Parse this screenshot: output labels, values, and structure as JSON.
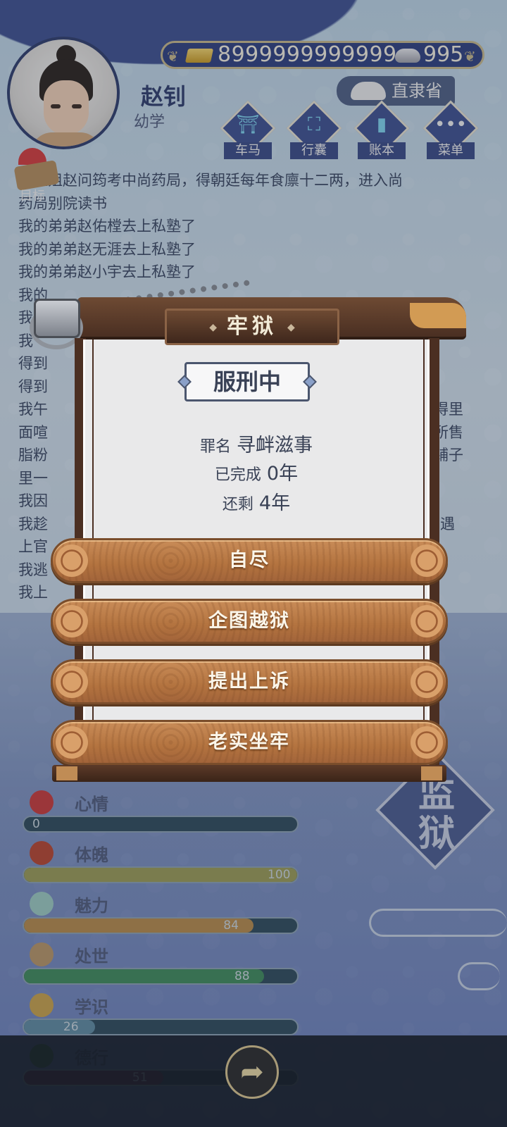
{
  "header": {
    "gold": "8999999999999",
    "silver": "995",
    "name": "赵钊",
    "rank": "幼学",
    "province": "直隶省",
    "nav": [
      {
        "label": "车马",
        "icon": "carriage-icon"
      },
      {
        "label": "行囊",
        "icon": "bag-icon"
      },
      {
        "label": "账本",
        "icon": "ledger-icon"
      },
      {
        "label": "菜单",
        "icon": "menu-icon"
      }
    ],
    "goal_label": "目标"
  },
  "log": [
    "我姐姐赵问筠考中尚药局，得朝廷每年食廪十二两，进入尚",
    "药局别院读书",
    "我的弟弟赵佑樘去上私塾了",
    "我的弟弟赵无涯去上私塾了",
    "我的弟弟赵小宇去上私塾了",
    "我的",
    "我",
    "我",
    "得到",
    "得到",
    "我午",
    "面喧",
    "脂粉",
    "里一",
    "我因",
    "我趁",
    "上官",
    "我逃",
    "我上"
  ],
  "log_right": [
    "得里",
    "所售",
    "铺子",
    "，遇"
  ],
  "modal": {
    "title": "牢狱",
    "status": "服刑中",
    "crime_label": "罪名",
    "crime": "寻衅滋事",
    "done_label": "已完成",
    "done": "0年",
    "remain_label": "还剩",
    "remain": "4年",
    "actions": [
      "自尽",
      "企图越狱",
      "提出上诉",
      "老实坐牢"
    ]
  },
  "stats": [
    {
      "name": "心情",
      "value": 0,
      "max": 100,
      "color": "#5a7a8a",
      "icon_color": "#c83a3a"
    },
    {
      "name": "体魄",
      "value": 100,
      "max": 100,
      "color": "#9a9a55",
      "icon_color": "#b8442e"
    },
    {
      "name": "魅力",
      "value": 84,
      "max": 100,
      "color": "#b68a4a",
      "icon_color": "#9cc9c0"
    },
    {
      "name": "处世",
      "value": 88,
      "max": 100,
      "color": "#3f8a5a",
      "icon_color": "#b89566"
    },
    {
      "name": "学识",
      "value": 26,
      "max": 100,
      "color": "#5f8aa0",
      "icon_color": "#c8a14a"
    },
    {
      "name": "德行",
      "value": 51,
      "max": 100,
      "color": "#6e2a4a",
      "icon_color": "#3b7a3b"
    }
  ],
  "side_badge": "监狱",
  "colors": {
    "accent": "#3d4f8f",
    "wood": "#b3733f",
    "gold": "#d9c48e"
  }
}
